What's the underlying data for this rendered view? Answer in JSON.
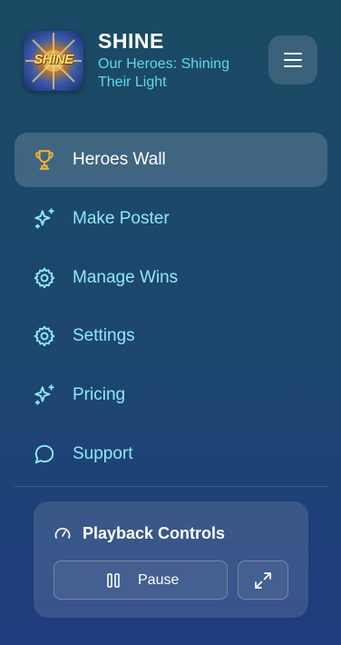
{
  "header": {
    "logo_text": "SHINE",
    "title": "SHINE",
    "subtitle": "Our Heroes: Shining Their Light",
    "menu_icon": "hamburger-menu-icon"
  },
  "nav": {
    "items": [
      {
        "label": "Heroes Wall",
        "icon": "trophy-icon",
        "active": true
      },
      {
        "label": "Make Poster",
        "icon": "sparkles-icon",
        "active": false
      },
      {
        "label": "Manage Wins",
        "icon": "gear-icon",
        "active": false
      },
      {
        "label": "Settings",
        "icon": "gear-icon",
        "active": false
      },
      {
        "label": "Pricing",
        "icon": "sparkles-icon",
        "active": false
      },
      {
        "label": "Support",
        "icon": "chat-bubble-icon",
        "active": false
      }
    ]
  },
  "playback": {
    "title": "Playback Controls",
    "title_icon": "gauge-icon",
    "pause_label": "Pause",
    "pause_icon": "pause-icon",
    "fullscreen_icon": "expand-icon"
  },
  "colors": {
    "accent": "#8fe8f5",
    "subtitle": "#5fd9ea",
    "trophy": "#f2b233",
    "background_top": "#1b4a63",
    "background_bottom": "#1f3c7e"
  }
}
